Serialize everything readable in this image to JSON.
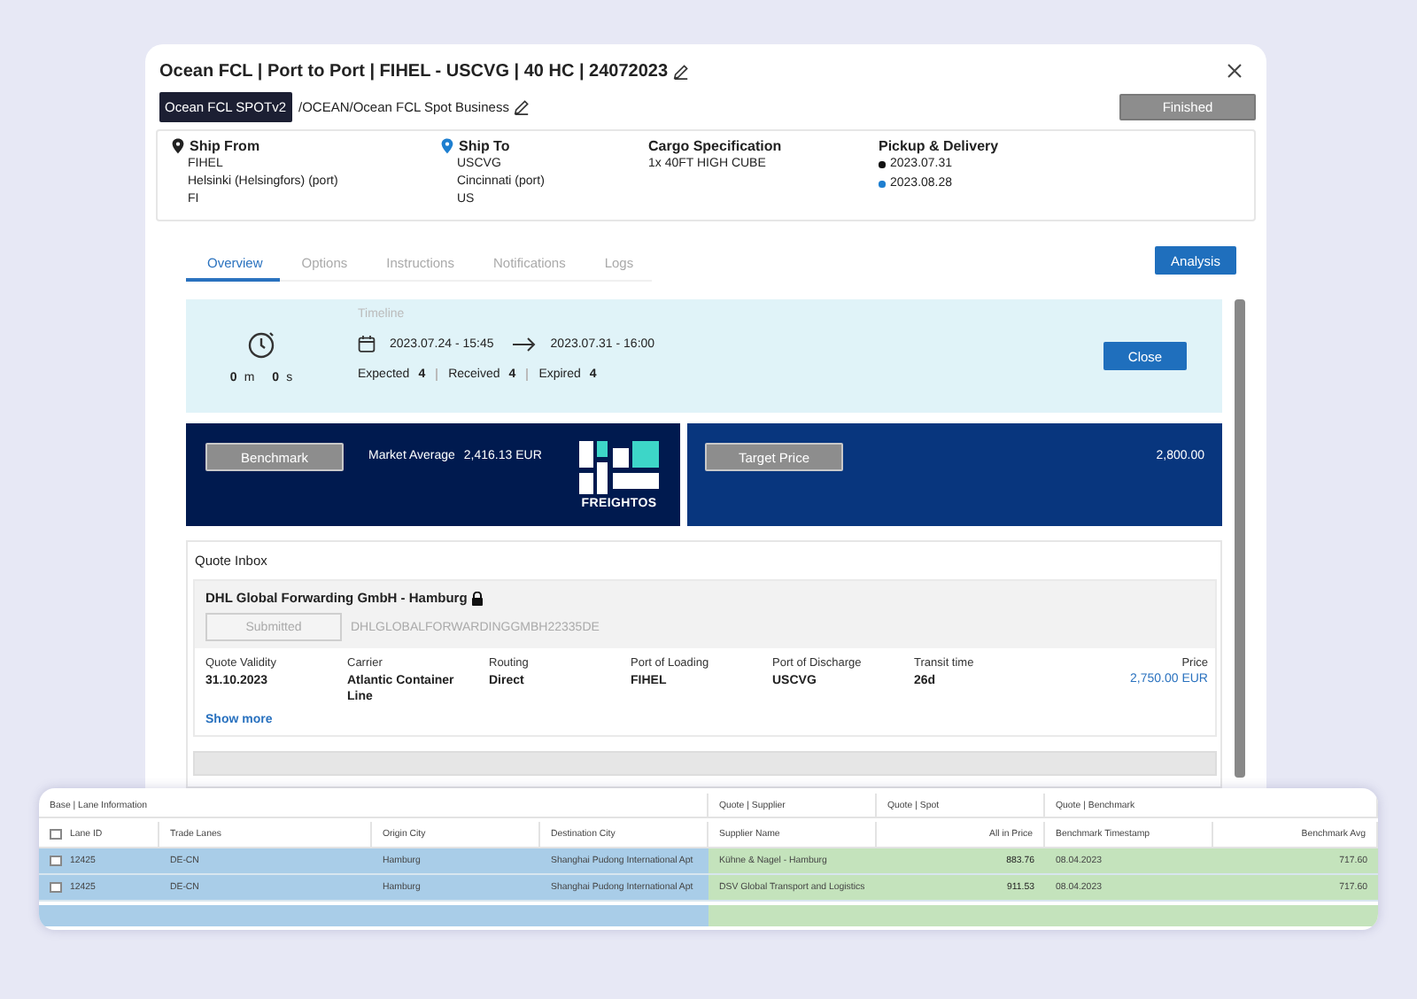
{
  "dialog": {
    "title": "Ocean FCL | Port to Port | FIHEL - USCVG | 40 HC | 24072023",
    "template_badge": "Ocean FCL SPOTv2",
    "path": "/OCEAN/Ocean FCL Spot Business",
    "status_button": "Finished",
    "route": [
      {
        "kind": "origin",
        "heading": "Ship From",
        "lines": [
          "FIHEL",
          "Helsinki (Helsingfors) (port)",
          "FI"
        ]
      },
      {
        "kind": "destination",
        "heading": "Ship To",
        "lines": [
          "USCVG",
          "Cincinnati (port)",
          "US"
        ]
      },
      {
        "kind": "cargo",
        "heading": "Cargo Specification",
        "lines": [
          "1x 40FT HIGH CUBE"
        ]
      },
      {
        "kind": "dates",
        "heading": "Pickup & Delivery",
        "dates": [
          {
            "date": "2023.07.31",
            "color": "#111111"
          },
          {
            "date": "2023.08.28",
            "color": "#1e7fd0"
          }
        ]
      }
    ],
    "tabs": [
      {
        "label": "Overview",
        "selected": true
      },
      {
        "label": "Options",
        "selected": false
      },
      {
        "label": "Instructions",
        "selected": false
      },
      {
        "label": "Notifications",
        "selected": false
      },
      {
        "label": "Logs",
        "selected": false
      }
    ],
    "analysis_button": "Analysis",
    "timeline": {
      "countdown": [
        {
          "value": "0",
          "unit": "m"
        },
        {
          "value": "0",
          "unit": "s"
        }
      ],
      "label": "Timeline",
      "start": "2023.07.24 - 15:45",
      "end": "2023.07.31 - 16:00",
      "counts": [
        {
          "label": "Expected",
          "value": "4"
        },
        {
          "label": "Received",
          "value": "4"
        },
        {
          "label": "Expired",
          "value": "4"
        }
      ],
      "close_button": "Close"
    },
    "benchmark": {
      "button": "Benchmark",
      "label": "Market Average",
      "value": "2,416.13 EUR",
      "logo_text": "FREIGHTOS"
    },
    "target": {
      "button": "Target Price",
      "value": "2,800.00"
    },
    "quote_inbox": {
      "title": "Quote Inbox",
      "quotes": [
        {
          "supplier": "DHL Global Forwarding GmbH - Hamburg",
          "locked": true,
          "status_button": "Submitted",
          "code": "DHLGLOBALFORWARDINGGMBH22335DE",
          "fields": [
            {
              "label": "Quote Validity",
              "value": "31.10.2023"
            },
            {
              "label": "Carrier",
              "value": "Atlantic Container Line"
            },
            {
              "label": "Routing",
              "value": "Direct"
            },
            {
              "label": "Port of Loading",
              "value": "FIHEL"
            },
            {
              "label": "Port of Discharge",
              "value": "USCVG"
            },
            {
              "label": "Transit time",
              "value": "26d"
            }
          ],
          "price_label": "Price",
          "price": "2,750.00 EUR",
          "show_more": "Show more"
        }
      ]
    }
  },
  "table": {
    "groups": [
      "Base | Lane Information",
      "Quote | Supplier",
      "Quote | Spot",
      "Quote | Benchmark"
    ],
    "columns": [
      "Lane ID",
      "Trade Lanes",
      "Origin City",
      "Destination City",
      "Supplier Name",
      "All in Price",
      "Benchmark Timestamp",
      "Benchmark Avg"
    ],
    "all_checked": false,
    "rows": [
      {
        "checked": false,
        "cells": [
          "12425",
          "DE-CN",
          "Hamburg",
          "Shanghai Pudong International Apt",
          "Kühne & Nagel - Hamburg",
          "883.76",
          "08.04.2023",
          "717.60"
        ]
      },
      {
        "checked": false,
        "cells": [
          "12425",
          "DE-CN",
          "Hamburg",
          "Shanghai Pudong International Apt",
          "DSV Global Transport and Logistics",
          "911.53",
          "08.04.2023",
          "717.60"
        ]
      }
    ]
  }
}
